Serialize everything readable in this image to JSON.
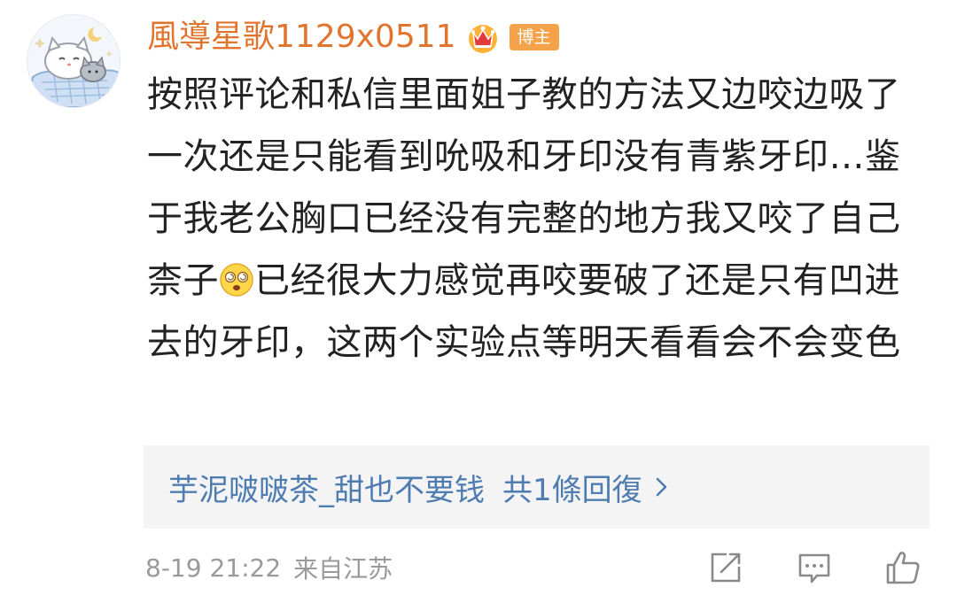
{
  "comment": {
    "username": "風導星歌1129x0511",
    "badge": "博主",
    "text_before_emoji": "按照评论和私信里面姐子教的方法又边咬边吸了一次还是只能看到吮吸和牙印没有青紫牙印…鉴于我老公胸口已经没有完整的地方我又咬了自己柰子",
    "text_after_emoji": "已经很大力感觉再咬要破了还是只有凹进去的牙印，这两个实验点等明天看看会不会变色",
    "time": "8-19 21:22",
    "location": "来自江苏"
  },
  "reply_preview": {
    "author": "芋泥啵啵茶_甜也不要钱",
    "count_text": "共1條回復"
  },
  "icons": {
    "avatar": "cat-avatar",
    "crown": "crown-icon",
    "emoji": "dizzy-face-emoji",
    "chevron": "chevron-right-icon",
    "share": "share-icon",
    "comment": "comment-icon",
    "like": "thumbs-up-icon"
  },
  "colors": {
    "username": "#e0752f",
    "badge_bg": "#f5a34a",
    "link": "#4e7cb0",
    "meta": "#9a9a9a"
  }
}
